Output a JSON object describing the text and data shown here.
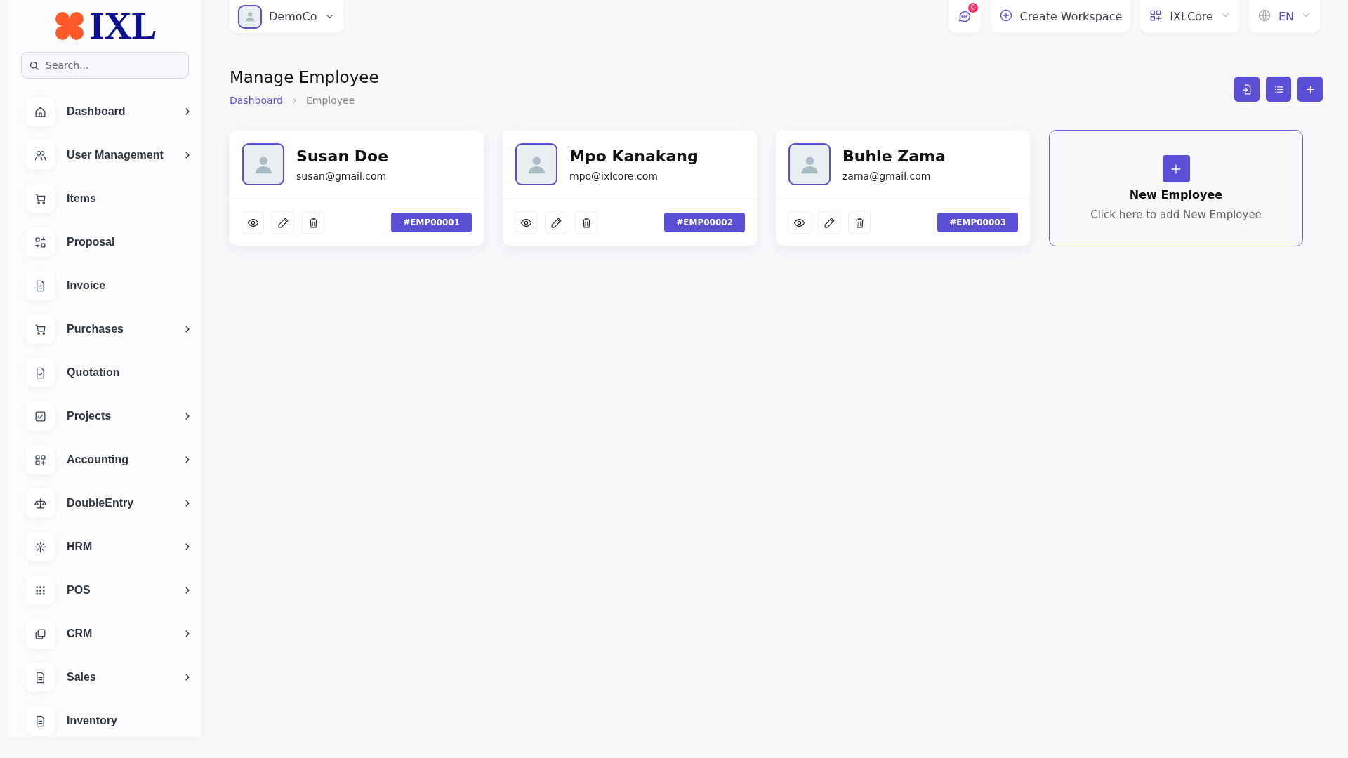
{
  "logo": {
    "text": "IXL"
  },
  "search": {
    "placeholder": "Search..."
  },
  "sidebar": {
    "items": [
      {
        "label": "Dashboard",
        "expandable": true
      },
      {
        "label": "User Management",
        "expandable": true
      },
      {
        "label": "Items",
        "expandable": false
      },
      {
        "label": "Proposal",
        "expandable": false
      },
      {
        "label": "Invoice",
        "expandable": false
      },
      {
        "label": "Purchases",
        "expandable": true
      },
      {
        "label": "Quotation",
        "expandable": false
      },
      {
        "label": "Projects",
        "expandable": true
      },
      {
        "label": "Accounting",
        "expandable": true
      },
      {
        "label": "DoubleEntry",
        "expandable": true
      },
      {
        "label": "HRM",
        "expandable": true
      },
      {
        "label": "POS",
        "expandable": true
      },
      {
        "label": "CRM",
        "expandable": true
      },
      {
        "label": "Sales",
        "expandable": true
      },
      {
        "label": "Inventory",
        "expandable": false
      }
    ]
  },
  "topbar": {
    "company": "DemoCo",
    "messages_badge": "0",
    "create_workspace": "Create Workspace",
    "workspace": "IXLCore",
    "language": "EN"
  },
  "page": {
    "title": "Manage Employee",
    "breadcrumb": [
      "Dashboard",
      "Employee"
    ]
  },
  "employees": [
    {
      "name": "Susan Doe",
      "email": "susan@gmail.com",
      "id": "#EMP00001"
    },
    {
      "name": "Mpo Kanakang",
      "email": "mpo@ixlcore.com",
      "id": "#EMP00002"
    },
    {
      "name": "Buhle Zama",
      "email": "zama@gmail.com",
      "id": "#EMP00003"
    }
  ],
  "new_card": {
    "title": "New Employee",
    "subtitle": "Click here to add New Employee"
  }
}
